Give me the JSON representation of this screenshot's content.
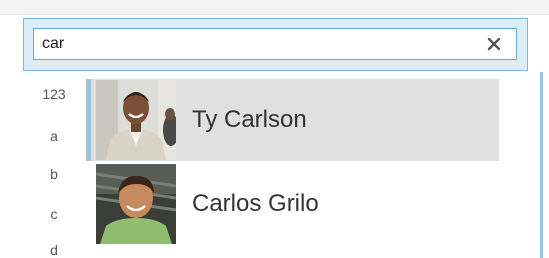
{
  "search": {
    "value": "car",
    "clear_icon": "close-icon"
  },
  "index": {
    "items": [
      "123",
      "a",
      "b",
      "c",
      "d"
    ]
  },
  "contacts": [
    {
      "name": "Ty Carlson",
      "selected": true,
      "avatar_icon": "person-photo"
    },
    {
      "name": "Carlos Grilo",
      "selected": false,
      "avatar_icon": "person-photo"
    }
  ],
  "colors": {
    "selection_bg": "#e0e0e0",
    "selection_bar": "#9cc3d9",
    "search_border": "#6aa5d6",
    "search_panel_bg": "#dcecf8"
  }
}
